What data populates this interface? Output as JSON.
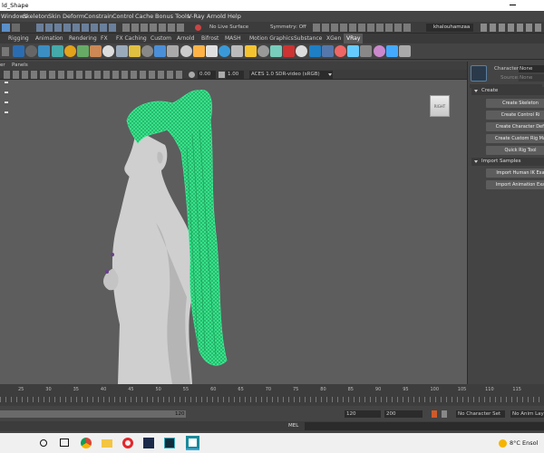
{
  "title_bar": {
    "text": "ld_Shape"
  },
  "menu": [
    "Windows",
    "Skeleton",
    "Skin",
    "Deform",
    "Constrain",
    "Control",
    "Cache",
    "Bonus Tools",
    "V-Ray",
    "Arnold",
    "Help"
  ],
  "status_line": {
    "live_surface": "No Live Surface",
    "symmetry": "Symmetry: Off",
    "user": "khalouhamzaa"
  },
  "shelf_tabs": [
    "Rigging",
    "Animation",
    "Rendering",
    "FX",
    "FX Caching",
    "Custom",
    "Arnold",
    "Bifrost",
    "MASH",
    "Motion Graphics",
    "Substance",
    "XGen",
    "VRay"
  ],
  "shelf_active": "VRay",
  "panel_menu": {
    "items": [
      "er",
      "Panels"
    ]
  },
  "viewport_toolbar": {
    "exposure": "0.00",
    "gamma": "1.00",
    "color_space": "ACES 1.0 SDR-video (sRGB)"
  },
  "viewcube": {
    "label": "RIGHT"
  },
  "hik_panel": {
    "character_label": "Character:",
    "character_value": "None",
    "source_label": "Source:",
    "source_value": "None",
    "create_section": "Create",
    "create_buttons": [
      "Create Skeleton",
      "Create Control Ri",
      "Create Character Defi",
      "Create Custom Rig Ma",
      "Quick Rig Tool"
    ],
    "import_section": "Import Samples",
    "import_buttons": [
      "Import Human IK Exa",
      "Import Animation Exa"
    ]
  },
  "timeline": {
    "ticks": [
      "25",
      "30",
      "35",
      "40",
      "45",
      "50",
      "55",
      "60",
      "65",
      "70",
      "75",
      "80",
      "85",
      "90",
      "95",
      "100",
      "105",
      "110",
      "115"
    ],
    "range_start": "120",
    "range_end": "120",
    "range_end2": "200",
    "character_set": "No Character Set",
    "anim_layer": "No Anim Layer"
  },
  "command_line": {
    "label": "MEL"
  },
  "taskbar": {
    "weather": "8°C  Ensol"
  },
  "colors": {
    "wireframe": "#3ef59a",
    "viewport_bg": "#5d5d5d",
    "body": "#c9c9c9"
  }
}
